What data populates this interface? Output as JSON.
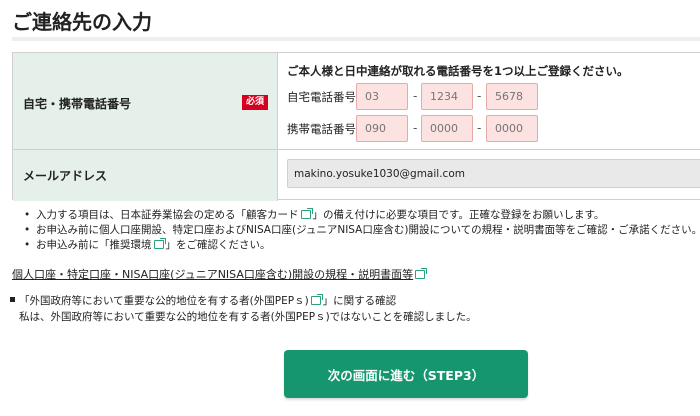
{
  "page": {
    "title": "ご連絡先の入力"
  },
  "phone": {
    "label": "自宅・携帯電話番号",
    "required_badge": "必須",
    "note": "ご本人様と日中連絡が取れる電話番号を1つ以上ご登録ください。",
    "home": {
      "label": "自宅電話番号",
      "placeholders": [
        "03",
        "1234",
        "5678"
      ],
      "separator": "-"
    },
    "mobile": {
      "label": "携帯電話番号",
      "placeholders": [
        "090",
        "0000",
        "0000"
      ],
      "separator": "-"
    }
  },
  "email": {
    "label": "メールアドレス",
    "value": "makino.yosuke1030@gmail.com"
  },
  "bullets": [
    {
      "before": "入力する項目は、日本証券業協会の定める「顧客カード",
      "after": "」の備え付けに必要な項目です。正確な登録をお願いします。"
    },
    {
      "text": "お申込み前に個人口座開設、特定口座およびNISA口座(ジュニアNISA口座含む)開設についての規程・説明書面等をご確認・ご承諾ください。"
    },
    {
      "before": "お申込み前に「推奨環境",
      "after": "」をご確認ください。"
    }
  ],
  "rules_link": "個人口座・特定口座・NISA口座(ジュニアNISA口座含む)開設の規程・説明書面等",
  "pep": {
    "heading_before": "「外国政府等において重要な公的地位を有する者(外国PEPｓ)",
    "heading_after": "」に関する確認",
    "statement": "私は、外国政府等において重要な公的地位を有する者(外国PEPｓ)ではないことを確認しました。"
  },
  "next_button": "次の画面に進む（STEP3）",
  "colors": {
    "accent": "#16966f",
    "label_bg": "#e6f0ea",
    "required": "#d4001d",
    "input_error_bg": "#fde2e2"
  },
  "icons": {
    "external_link": "external-link-icon"
  }
}
